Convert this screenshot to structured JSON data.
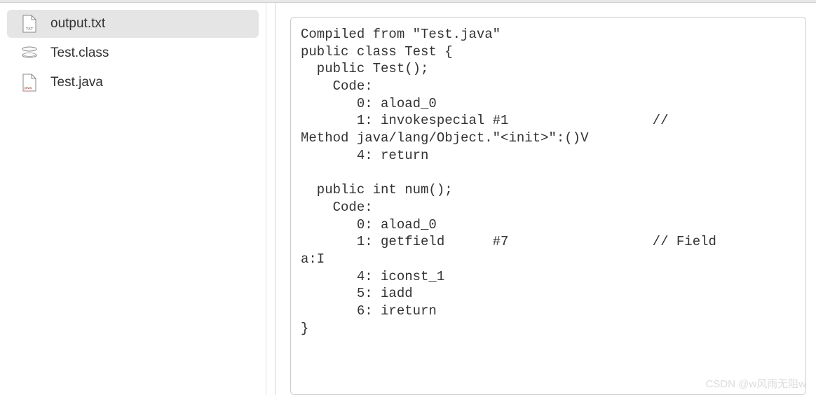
{
  "sidebar": {
    "items": [
      {
        "name": "output.txt",
        "type": "txt",
        "selected": true
      },
      {
        "name": "Test.class",
        "type": "class",
        "selected": false
      },
      {
        "name": "Test.java",
        "type": "java",
        "selected": false
      }
    ]
  },
  "content": {
    "text": "Compiled from \"Test.java\"\npublic class Test {\n  public Test();\n    Code:\n       0: aload_0\n       1: invokespecial #1                  // \nMethod java/lang/Object.\"<init>\":()V\n       4: return\n\n  public int num();\n    Code:\n       0: aload_0\n       1: getfield      #7                  // Field \na:I\n       4: iconst_1\n       5: iadd\n       6: ireturn\n}"
  },
  "watermark": "CSDN @w风雨无阻w"
}
